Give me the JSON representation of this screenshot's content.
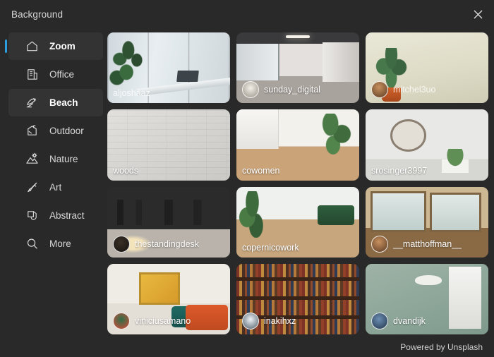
{
  "window": {
    "title": "Background",
    "close_icon": "close-icon"
  },
  "sidebar": {
    "items": [
      {
        "label": "Zoom",
        "icon": "home-icon",
        "active": true,
        "selected": false
      },
      {
        "label": "Office",
        "icon": "building-icon",
        "active": false,
        "selected": false
      },
      {
        "label": "Beach",
        "icon": "umbrella-icon",
        "active": false,
        "selected": true
      },
      {
        "label": "Outdoor",
        "icon": "tent-icon",
        "active": false,
        "selected": false
      },
      {
        "label": "Nature",
        "icon": "mountain-icon",
        "active": false,
        "selected": false
      },
      {
        "label": "Art",
        "icon": "brush-icon",
        "active": false,
        "selected": false
      },
      {
        "label": "Abstract",
        "icon": "shapes-icon",
        "active": false,
        "selected": false
      },
      {
        "label": "More",
        "icon": "search-icon",
        "active": false,
        "selected": false
      }
    ]
  },
  "gallery": {
    "tiles": [
      {
        "username": "aljoshaaz",
        "has_avatar": false,
        "art": "th-office-window",
        "avatar_class": "av-a",
        "faint": true
      },
      {
        "username": "sunday_digital",
        "has_avatar": true,
        "art": "th-corridor",
        "avatar_class": "av-c",
        "faint": false
      },
      {
        "username": "mitchel3uo",
        "has_avatar": true,
        "art": "th-plantwall",
        "avatar_class": "av-b",
        "faint": true
      },
      {
        "username": "woods",
        "has_avatar": false,
        "art": "th-brick",
        "avatar_class": "av-a",
        "faint": false
      },
      {
        "username": "cowomen",
        "has_avatar": false,
        "art": "th-coliving",
        "avatar_class": "av-a",
        "faint": false
      },
      {
        "username": "srosinger3997",
        "has_avatar": false,
        "art": "th-clock",
        "avatar_class": "av-a",
        "faint": false
      },
      {
        "username": "thestandingdesk",
        "has_avatar": true,
        "art": "th-darkdesk",
        "avatar_class": "av-g",
        "faint": false
      },
      {
        "username": "copernicowork",
        "has_avatar": false,
        "art": "th-greenoffice",
        "avatar_class": "av-a",
        "faint": false
      },
      {
        "username": "__matthoffman__",
        "has_avatar": true,
        "art": "th-cafewindow",
        "avatar_class": "av-b",
        "faint": false
      },
      {
        "username": "viniciusamano",
        "has_avatar": true,
        "art": "th-livingroom",
        "avatar_class": "av-d",
        "faint": false
      },
      {
        "username": "inakihxz",
        "has_avatar": true,
        "art": "th-library",
        "avatar_class": "av-e",
        "faint": false
      },
      {
        "username": "dvandijk",
        "has_avatar": true,
        "art": "th-greenlamp",
        "avatar_class": "av-f",
        "faint": false
      }
    ]
  },
  "footer": {
    "attribution": "Powered by Unsplash"
  },
  "colors": {
    "window_bg": "#292929",
    "accent": "#2b9fe0",
    "selected_bg": "#333333",
    "text": "#d8d8d8"
  }
}
